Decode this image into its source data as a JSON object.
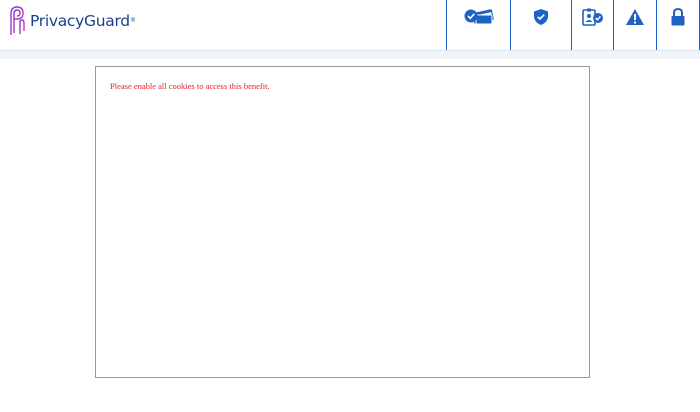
{
  "header": {
    "brand": "PrivacyGuard",
    "brand_mark": "®",
    "brand_color": "#1a3f8e",
    "accent_color": "#1e63c4",
    "nav_icons": [
      "credit-cards-check-icon",
      "shield-check-icon",
      "id-badge-check-icon",
      "warning-icon",
      "lock-icon"
    ]
  },
  "panel": {
    "message": "Please enable all cookies to access this benefit.",
    "message_color": "#e8202a"
  }
}
